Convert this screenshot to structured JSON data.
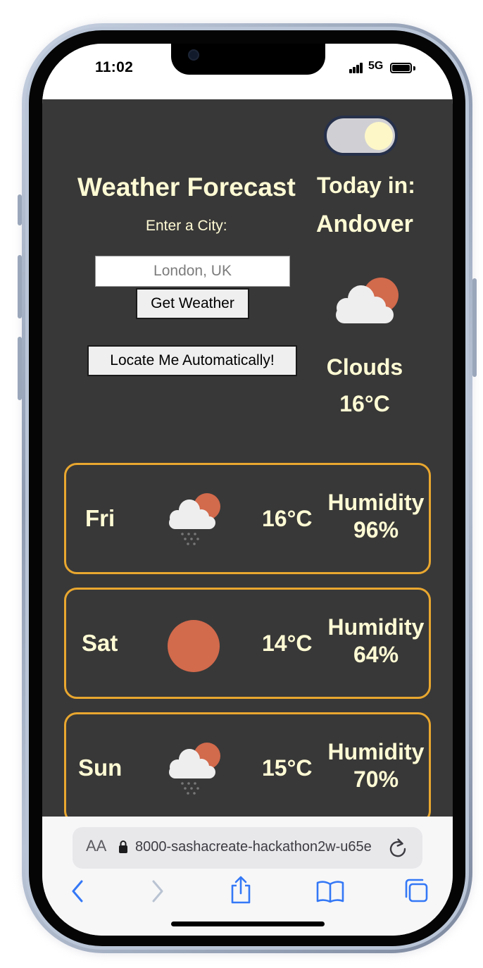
{
  "status_bar": {
    "time": "11:02",
    "network": "5G"
  },
  "app": {
    "title": "Weather Forecast",
    "city_prompt": "Enter a City:",
    "city_input": {
      "value": "",
      "placeholder": "London, UK"
    },
    "get_weather_label": "Get Weather",
    "locate_label": "Locate Me Automatically!",
    "today": {
      "label": "Today in:",
      "city": "Andover",
      "condition": "Clouds",
      "temp": "16°C",
      "icon": "sun-behind-cloud-icon"
    },
    "forecast": [
      {
        "day": "Fri",
        "temp": "16°C",
        "humidity_label": "Humidity",
        "humidity": "96%",
        "icon": "sun-cloud-rain-icon"
      },
      {
        "day": "Sat",
        "temp": "14°C",
        "humidity_label": "Humidity",
        "humidity": "64%",
        "icon": "sun-icon"
      },
      {
        "day": "Sun",
        "temp": "15°C",
        "humidity_label": "Humidity",
        "humidity": "70%",
        "icon": "sun-cloud-rain-icon"
      }
    ]
  },
  "browser": {
    "aa_label": "AA",
    "url": "8000-sashacreate-hackathon2w-u65e"
  },
  "colors": {
    "app_background": "#383838",
    "text": "#fffbd4",
    "card_border": "#e9a72f",
    "sun": "#d26a4c",
    "toolbar_icons": "#3478f6"
  }
}
